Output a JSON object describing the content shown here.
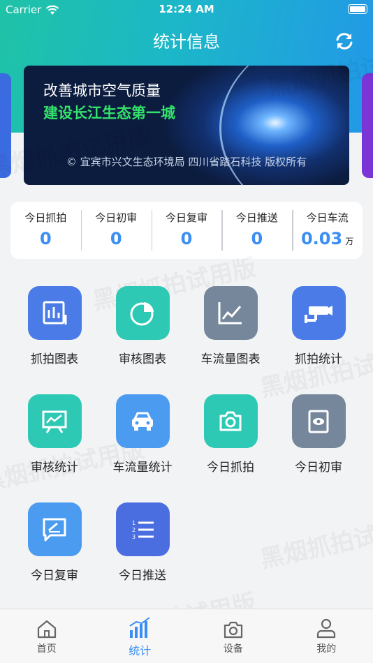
{
  "status_bar": {
    "carrier": "Carrier",
    "time": "12:24 AM"
  },
  "nav": {
    "title": "统计信息"
  },
  "banner": {
    "line1": "改善城市空气质量",
    "line2": "建设长江生态第一城",
    "copyright": "© 宜宾市兴文生态环境局 四川省踏石科技 版权所有"
  },
  "stats": [
    {
      "label": "今日抓拍",
      "value": "0",
      "unit": ""
    },
    {
      "label": "今日初审",
      "value": "0",
      "unit": ""
    },
    {
      "label": "今日复审",
      "value": "0",
      "unit": ""
    },
    {
      "label": "今日推送",
      "value": "0",
      "unit": ""
    },
    {
      "label": "今日车流",
      "value": "0.03",
      "unit": "万"
    }
  ],
  "menu": [
    {
      "label": "抓拍图表",
      "icon": "bar-chart-icon",
      "color": "#4a7be6"
    },
    {
      "label": "审核图表",
      "icon": "pie-chart-icon",
      "color": "#2ec9b4"
    },
    {
      "label": "车流量图表",
      "icon": "line-chart-icon",
      "color": "#76879c"
    },
    {
      "label": "抓拍统计",
      "icon": "camera-cctv-icon",
      "color": "#4a7be6"
    },
    {
      "label": "审核统计",
      "icon": "presentation-icon",
      "color": "#2ec9b4"
    },
    {
      "label": "车流量统计",
      "icon": "car-icon",
      "color": "#4b9bf0"
    },
    {
      "label": "今日抓拍",
      "icon": "camera-icon",
      "color": "#2ec9b4"
    },
    {
      "label": "今日初审",
      "icon": "eye-monitor-icon",
      "color": "#76879c"
    },
    {
      "label": "今日复审",
      "icon": "edit-note-icon",
      "color": "#4b9bf0"
    },
    {
      "label": "今日推送",
      "icon": "list-icon",
      "color": "#4a6ee0"
    }
  ],
  "watermark": "黑烟抓拍试用版",
  "tabs": [
    {
      "label": "首页",
      "icon": "home-icon",
      "active": false
    },
    {
      "label": "统计",
      "icon": "stats-icon",
      "active": true
    },
    {
      "label": "设备",
      "icon": "device-camera-icon",
      "active": false
    },
    {
      "label": "我的",
      "icon": "user-icon",
      "active": false
    }
  ],
  "colors": {
    "accent": "#3b8ef3",
    "header_start": "#1fc3a6",
    "header_end": "#2298e8"
  }
}
